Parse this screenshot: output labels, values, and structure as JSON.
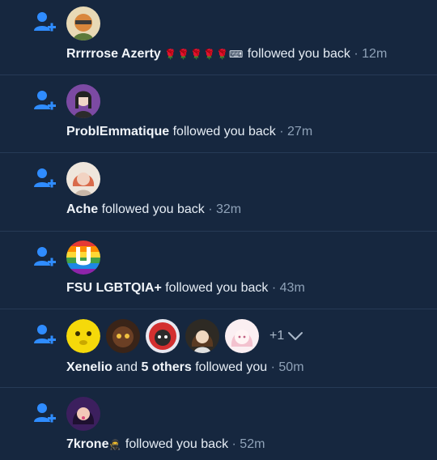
{
  "colors": {
    "background": "#16273f",
    "divider": "#263a56",
    "accent_blue": "#2f8cff",
    "text_primary": "#f1f5fa",
    "text_muted": "#8fa2b8"
  },
  "notifications": [
    {
      "icon": "person-add-icon",
      "name": "Rrrrrose Azerty",
      "name_suffix": "🌹🌹🌹🌹🌹⌨",
      "action": "followed you back",
      "separator": "·",
      "time": "12m"
    },
    {
      "icon": "person-add-icon",
      "name": "ProblEmmatique",
      "action": "followed you back",
      "separator": "·",
      "time": "27m"
    },
    {
      "icon": "person-add-icon",
      "name": "Ache",
      "action": "followed you back",
      "separator": "·",
      "time": "32m"
    },
    {
      "icon": "person-add-icon",
      "name": "FSU LGBTQIA+",
      "action": "followed you back",
      "separator": "·",
      "time": "43m"
    },
    {
      "icon": "person-add-icon",
      "name": "Xenelio",
      "conjunction": "and",
      "others": "5 others",
      "action": "followed you",
      "separator": "·",
      "time": "50m",
      "more_count": "+1"
    },
    {
      "icon": "person-add-icon",
      "name": "7krone",
      "name_suffix": "🥷",
      "action": "followed you back",
      "separator": "·",
      "time": "52m"
    }
  ]
}
